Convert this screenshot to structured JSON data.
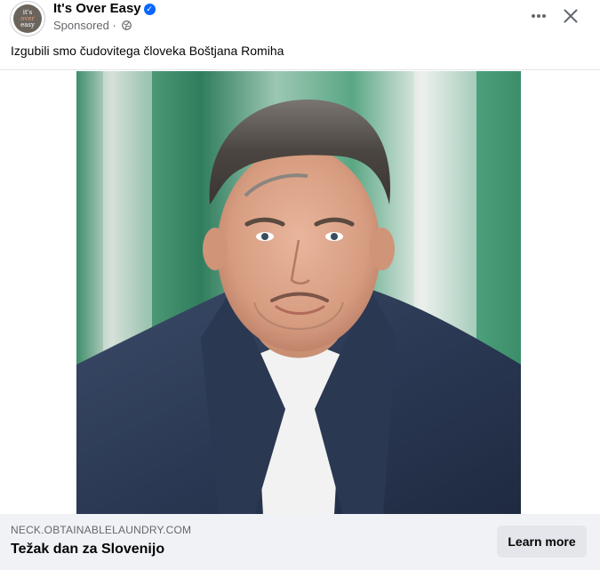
{
  "post": {
    "page_name": "It's Over Easy",
    "avatar_text": {
      "top": "it's",
      "middle": "over",
      "bottom": "easy"
    },
    "sponsored_label": "Sponsored",
    "separator": " · ",
    "caption": "Izgubili smo čudovitega človeka Boštjana Romiha",
    "icons": {
      "verified": "verified-badge-icon",
      "audience": "globe-icon",
      "more": "more-options-icon",
      "close": "close-icon"
    }
  },
  "link_preview": {
    "domain": "NECK.OBTAINABLELAUNDRY.COM",
    "headline": "Težak dan za Slovenijo",
    "cta_label": "Learn more"
  },
  "colors": {
    "verified_blue": "#0866ff",
    "footer_bg": "#f0f2f5",
    "button_bg": "#e4e6eb",
    "secondary_text": "#65676b"
  }
}
